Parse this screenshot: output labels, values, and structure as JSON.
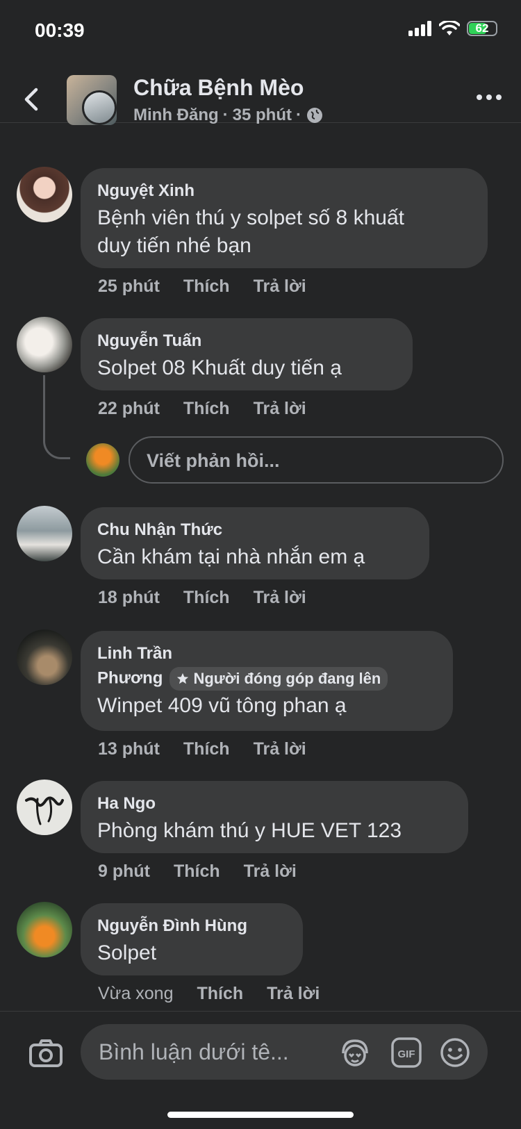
{
  "status": {
    "time": "00:39",
    "battery": "62"
  },
  "header": {
    "title": "Chữa Bệnh Mèo",
    "author": "Minh Đăng",
    "sep1": "·",
    "time": "35 phút",
    "sep2": "·"
  },
  "comments": [
    {
      "name": "Nguyệt Xinh",
      "line1": "Bệnh viên thú y solpet số 8 khuất",
      "line2": "duy tiến nhé bạn",
      "time": "25 phút",
      "like": "Thích",
      "reply": "Trả lời"
    },
    {
      "name": "Nguyễn Tuấn",
      "line1": "Solpet 08 Khuất duy tiến ạ",
      "time": "22 phút",
      "like": "Thích",
      "reply": "Trả lời"
    },
    {
      "name": "Chu Nhận Thức",
      "line1": "Cần khám tại nhà nhắn em ạ",
      "time": "18 phút",
      "like": "Thích",
      "reply": "Trả lời"
    },
    {
      "name1": "Linh Trần",
      "name2": "Phương",
      "badge": "Người đóng góp đang lên",
      "line1": "Winpet 409 vũ tông phan ạ",
      "time": "13 phút",
      "like": "Thích",
      "reply": "Trả lời"
    },
    {
      "name": "Ha Ngo",
      "line1": "Phòng khám thú y HUE VET 123",
      "time": "9 phút",
      "like": "Thích",
      "reply": "Trả lời"
    },
    {
      "name": "Nguyễn Đình Hùng",
      "line1": "Solpet",
      "time": "Vừa xong",
      "like": "Thích",
      "reply": "Trả lời"
    }
  ],
  "reply_placeholder": "Viết phản hồi...",
  "composer": {
    "placeholder": "Bình luận dưới tê...",
    "gif": "GIF"
  }
}
